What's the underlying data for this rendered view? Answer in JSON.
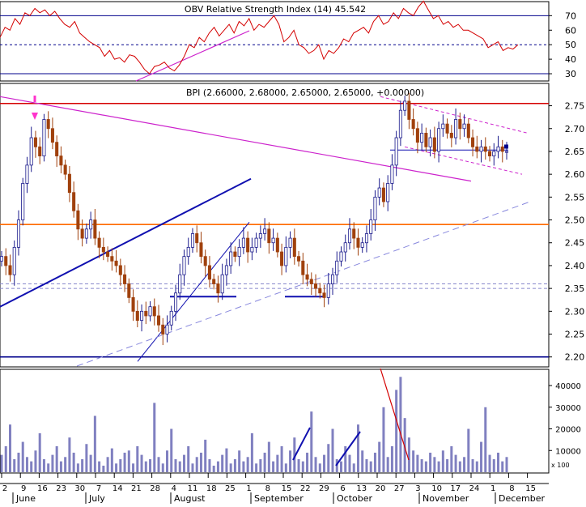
{
  "chart_data": [
    {
      "type": "line",
      "panel": "indicator",
      "title": "OBV Relative Strength Index (14) 45.542",
      "series": [
        {
          "name": "RSI (14)",
          "color": "#d40000",
          "values": [
            55,
            62,
            60,
            68,
            64,
            72,
            70,
            75,
            72,
            74,
            70,
            73,
            68,
            64,
            62,
            66,
            58,
            55,
            52,
            50,
            48,
            42,
            46,
            40,
            41,
            38,
            43,
            42,
            38,
            33,
            30,
            35,
            36,
            38,
            34,
            32,
            36,
            42,
            50,
            48,
            55,
            52,
            58,
            62,
            56,
            60,
            64,
            58,
            66,
            63,
            68,
            60,
            64,
            62,
            66,
            70,
            64,
            52,
            55,
            60,
            50,
            48,
            44,
            46,
            50,
            40,
            46,
            44,
            48,
            54,
            52,
            58,
            60,
            62,
            58,
            66,
            70,
            64,
            66,
            72,
            68,
            75,
            72,
            70,
            76,
            80,
            74,
            68,
            70,
            64,
            66,
            62,
            64,
            60,
            60,
            58,
            56,
            54,
            48,
            50,
            52,
            46,
            48,
            47,
            50
          ]
        }
      ],
      "reference_lines": [
        70,
        50,
        30
      ],
      "trendline_color": "#cc22cc",
      "y_ticks": [
        30,
        40,
        50,
        60,
        70
      ],
      "ylim": [
        25,
        78
      ]
    },
    {
      "type": "candlestick",
      "panel": "price",
      "title": "BPI (2.66000, 2.68000, 2.65000, 2.65000, +0.00000)",
      "up_color": "#ffffff",
      "down_color": "#a0410d",
      "y_ticks": [
        "2.20",
        "2.25",
        "2.30",
        "2.35",
        "2.40",
        "2.45",
        "2.50",
        "2.55",
        "2.60",
        "2.65",
        "2.70",
        "2.75"
      ],
      "ylim": [
        2.18,
        2.79
      ],
      "closes": [
        2.42,
        2.4,
        2.38,
        2.44,
        2.5,
        2.58,
        2.62,
        2.68,
        2.66,
        2.64,
        2.72,
        2.7,
        2.67,
        2.64,
        2.62,
        2.6,
        2.56,
        2.52,
        2.48,
        2.46,
        2.48,
        2.5,
        2.46,
        2.44,
        2.43,
        2.42,
        2.41,
        2.4,
        2.38,
        2.36,
        2.33,
        2.3,
        2.28,
        2.3,
        2.29,
        2.31,
        2.29,
        2.27,
        2.25,
        2.27,
        2.3,
        2.34,
        2.38,
        2.42,
        2.44,
        2.47,
        2.45,
        2.42,
        2.4,
        2.37,
        2.36,
        2.34,
        2.38,
        2.4,
        2.43,
        2.42,
        2.44,
        2.46,
        2.43,
        2.44,
        2.46,
        2.47,
        2.48,
        2.45,
        2.46,
        2.43,
        2.4,
        2.44,
        2.46,
        2.42,
        2.41,
        2.38,
        2.37,
        2.36,
        2.35,
        2.34,
        2.33,
        2.36,
        2.38,
        2.41,
        2.43,
        2.45,
        2.48,
        2.46,
        2.44,
        2.45,
        2.47,
        2.5,
        2.55,
        2.57,
        2.54,
        2.58,
        2.62,
        2.68,
        2.74,
        2.76,
        2.72,
        2.7,
        2.67,
        2.69,
        2.66,
        2.68,
        2.65,
        2.7,
        2.71,
        2.69,
        2.68,
        2.72,
        2.7,
        2.71,
        2.68,
        2.66,
        2.65,
        2.66,
        2.65,
        2.64,
        2.65,
        2.66,
        2.65,
        2.65
      ],
      "horizontal_lines": [
        {
          "value": 2.755,
          "color": "#d40000"
        },
        {
          "value": 2.49,
          "color": "#ff6a00"
        },
        {
          "value": 2.2,
          "color": "#00008b"
        },
        {
          "value": 2.36,
          "color": "#8888cc"
        },
        {
          "value": 2.35,
          "color": "#8888cc"
        }
      ],
      "marker_arrow_color": "#ff33cc"
    },
    {
      "type": "bar",
      "panel": "volume",
      "bar_color": "#8080c0",
      "y_ticks": [
        "10000",
        "20000",
        "30000",
        "40000"
      ],
      "y_unit_label": "x 100",
      "ylim": [
        0,
        46000
      ],
      "values": [
        8000,
        12000,
        22000,
        6000,
        9000,
        14000,
        7000,
        5000,
        10000,
        18000,
        6000,
        4000,
        8000,
        12000,
        5000,
        7000,
        16000,
        9000,
        4000,
        6000,
        13000,
        8000,
        26000,
        5000,
        3000,
        7000,
        11000,
        4000,
        6000,
        9000,
        10000,
        4000,
        12000,
        8000,
        5000,
        6000,
        32000,
        7000,
        4000,
        10000,
        20000,
        6000,
        5000,
        8000,
        12000,
        4000,
        7000,
        9000,
        15000,
        6000,
        3000,
        5000,
        8000,
        11000,
        4000,
        6000,
        10000,
        5000,
        7000,
        18000,
        4000,
        6000,
        9000,
        14000,
        5000,
        8000,
        12000,
        4000,
        10000,
        16000,
        6000,
        5000,
        9000,
        28000,
        7000,
        4000,
        8000,
        13000,
        20000,
        6000,
        5000,
        12000,
        8000,
        4000,
        22000,
        10000,
        6000,
        5000,
        9000,
        14000,
        30000,
        7000,
        12000,
        38000,
        44000,
        25000,
        16000,
        10000,
        8000,
        6000,
        5000,
        9000,
        7000,
        5000,
        10000,
        6000,
        12000,
        8000,
        5000,
        7000,
        20000,
        6000,
        5000,
        14000,
        30000,
        8000,
        6000,
        9000,
        5000,
        7000
      ]
    }
  ],
  "x_axis": {
    "day_labels": [
      "2",
      "9",
      "16",
      "23",
      "30",
      "7",
      "14",
      "21",
      "28",
      "4",
      "11",
      "18",
      "25",
      "1",
      "8",
      "15",
      "22",
      "29",
      "6",
      "13",
      "20",
      "27",
      "3",
      "10",
      "17",
      "24",
      "1",
      "8",
      "15"
    ],
    "month_labels": [
      "June",
      "July",
      "August",
      "September",
      "October",
      "November",
      "December"
    ]
  }
}
